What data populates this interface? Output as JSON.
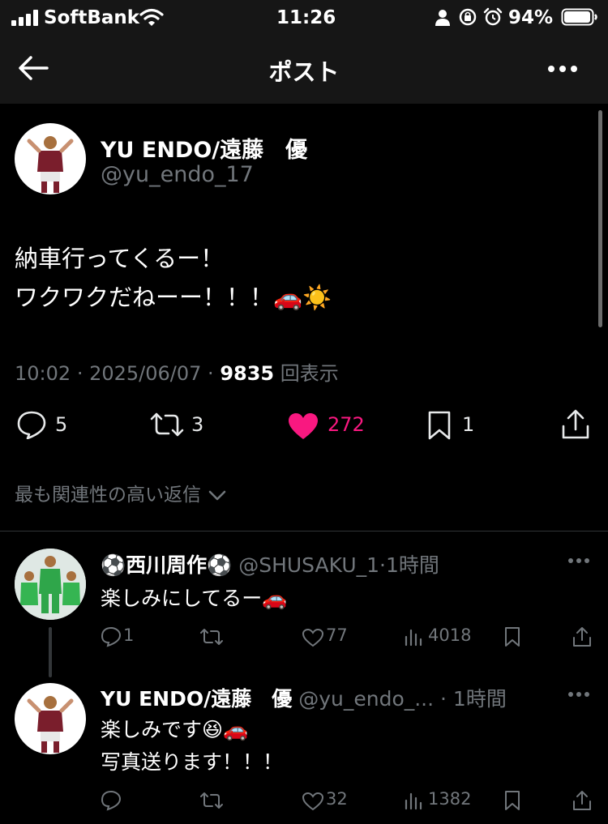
{
  "status_bar": {
    "carrier": "SoftBank",
    "time": "11:26",
    "battery_percent": "94%",
    "battery_level": 0.94
  },
  "nav": {
    "title": "ポスト"
  },
  "post": {
    "display_name": "YU ENDO/遠藤　優",
    "handle": "@yu_endo_17",
    "text_line1": "納車行ってくるー！",
    "text_line2": "ワクワクだねーー！！！",
    "text_line2_emoji": "🚗☀️",
    "time": "10:02",
    "date": "2025/06/07",
    "views_count": "9835",
    "views_label": "回表示",
    "replies": "5",
    "reposts": "3",
    "likes": "272",
    "bookmarks": "1",
    "like_color": "#f91880"
  },
  "reply_sort": {
    "label": "最も関連性の高い返信"
  },
  "replies": [
    {
      "display_name": "⚽西川周作⚽",
      "handle": "@SHUSAKU_1",
      "time": "1時間",
      "text_line1": "楽しみにしてるー🚗",
      "text_line2": "",
      "reply_count": "1",
      "repost_count": "",
      "like_count": "77",
      "view_count": "4018"
    },
    {
      "display_name": "YU ENDO/遠藤　優",
      "handle": "@yu_endo_...",
      "time": "1時間",
      "text_line1": "楽しみです😆🚗",
      "text_line2": "写真送ります！！！",
      "reply_count": "",
      "repost_count": "",
      "like_count": "32",
      "view_count": "1382"
    }
  ],
  "icons": [
    "signal-icon",
    "wifi-icon",
    "person-icon",
    "lock-rotation-icon",
    "alarm-icon",
    "battery-icon",
    "back-arrow-icon",
    "more-icon",
    "reply-icon",
    "repost-icon",
    "heart-icon",
    "bookmark-icon",
    "share-icon",
    "chevron-down-icon",
    "views-icon"
  ]
}
